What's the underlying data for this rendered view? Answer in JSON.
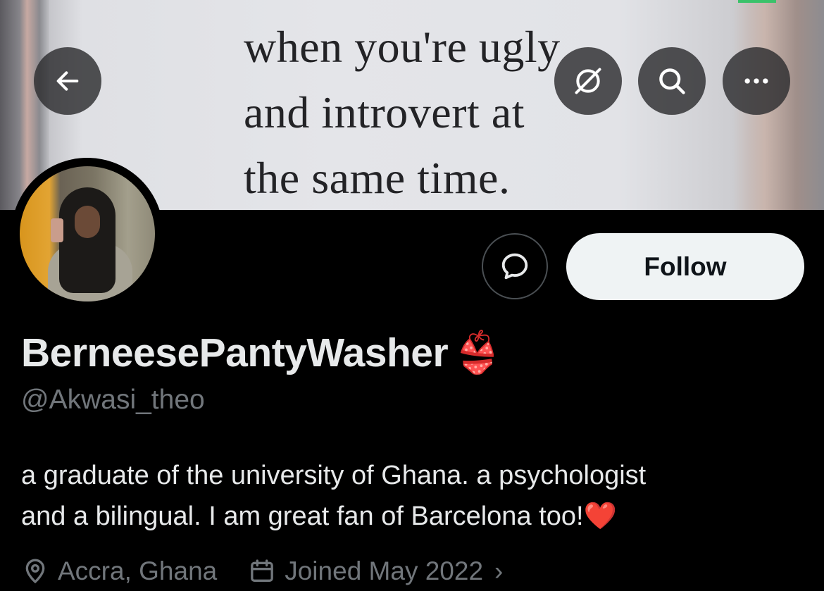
{
  "banner": {
    "quote_lines": [
      "when you're ugly",
      "and introvert at",
      "the same time."
    ]
  },
  "profile": {
    "display_name": "BerneesePantyWasher",
    "name_emoji": "👙",
    "handle": "@Akwasi_theo",
    "bio_lines": [
      "a graduate of the university of Ghana. a psychologist",
      "and a bilingual. I am great fan of Barcelona too!"
    ],
    "bio_emoji": "❤️",
    "location": "Accra, Ghana",
    "joined": "Joined May 2022",
    "joined_chevron": "›"
  },
  "actions": {
    "follow_label": "Follow"
  },
  "icons": {
    "back": "arrow-left-icon",
    "grok": "grok-icon",
    "search": "search-icon",
    "more": "more-icon",
    "message": "message-icon",
    "location": "location-pin-icon",
    "calendar": "calendar-icon"
  },
  "colors": {
    "background": "#000000",
    "primary_text": "#e7e9ea",
    "secondary_text": "#71767b",
    "follow_bg": "#eff3f4",
    "follow_text": "#0f1419"
  }
}
